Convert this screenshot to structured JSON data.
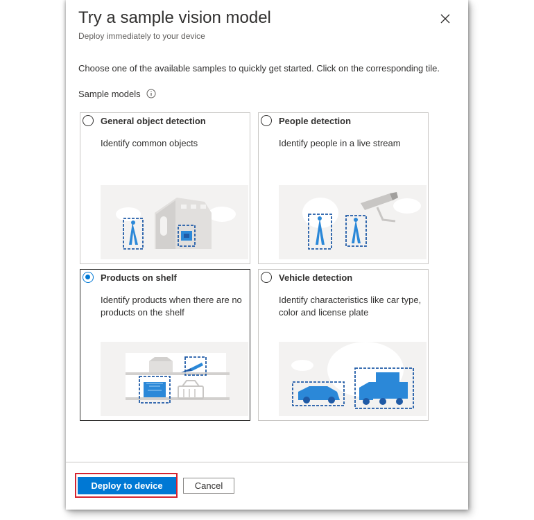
{
  "dialog": {
    "title": "Try a sample vision model",
    "subtitle": "Deploy immediately to your device",
    "close_icon": "close-icon"
  },
  "intro": "Choose one of the available samples to quickly get started. Click on the corresponding tile.",
  "sample_models": {
    "label": "Sample models",
    "info_icon": "info-icon"
  },
  "tiles": [
    {
      "title": "General object detection",
      "description": "Identify common objects",
      "selected": false
    },
    {
      "title": "People detection",
      "description": "Identify people in a live stream",
      "selected": false
    },
    {
      "title": "Products on shelf",
      "description": "Identify products when there are no products on the shelf",
      "selected": true
    },
    {
      "title": "Vehicle detection",
      "description": "Identify characteristics like car type, color and license plate",
      "selected": false
    }
  ],
  "footer": {
    "deploy_label": "Deploy to device",
    "cancel_label": "Cancel"
  },
  "colors": {
    "accent": "#0078d4",
    "highlight": "#d6232f",
    "illustration_bg": "#f3f2f1"
  }
}
